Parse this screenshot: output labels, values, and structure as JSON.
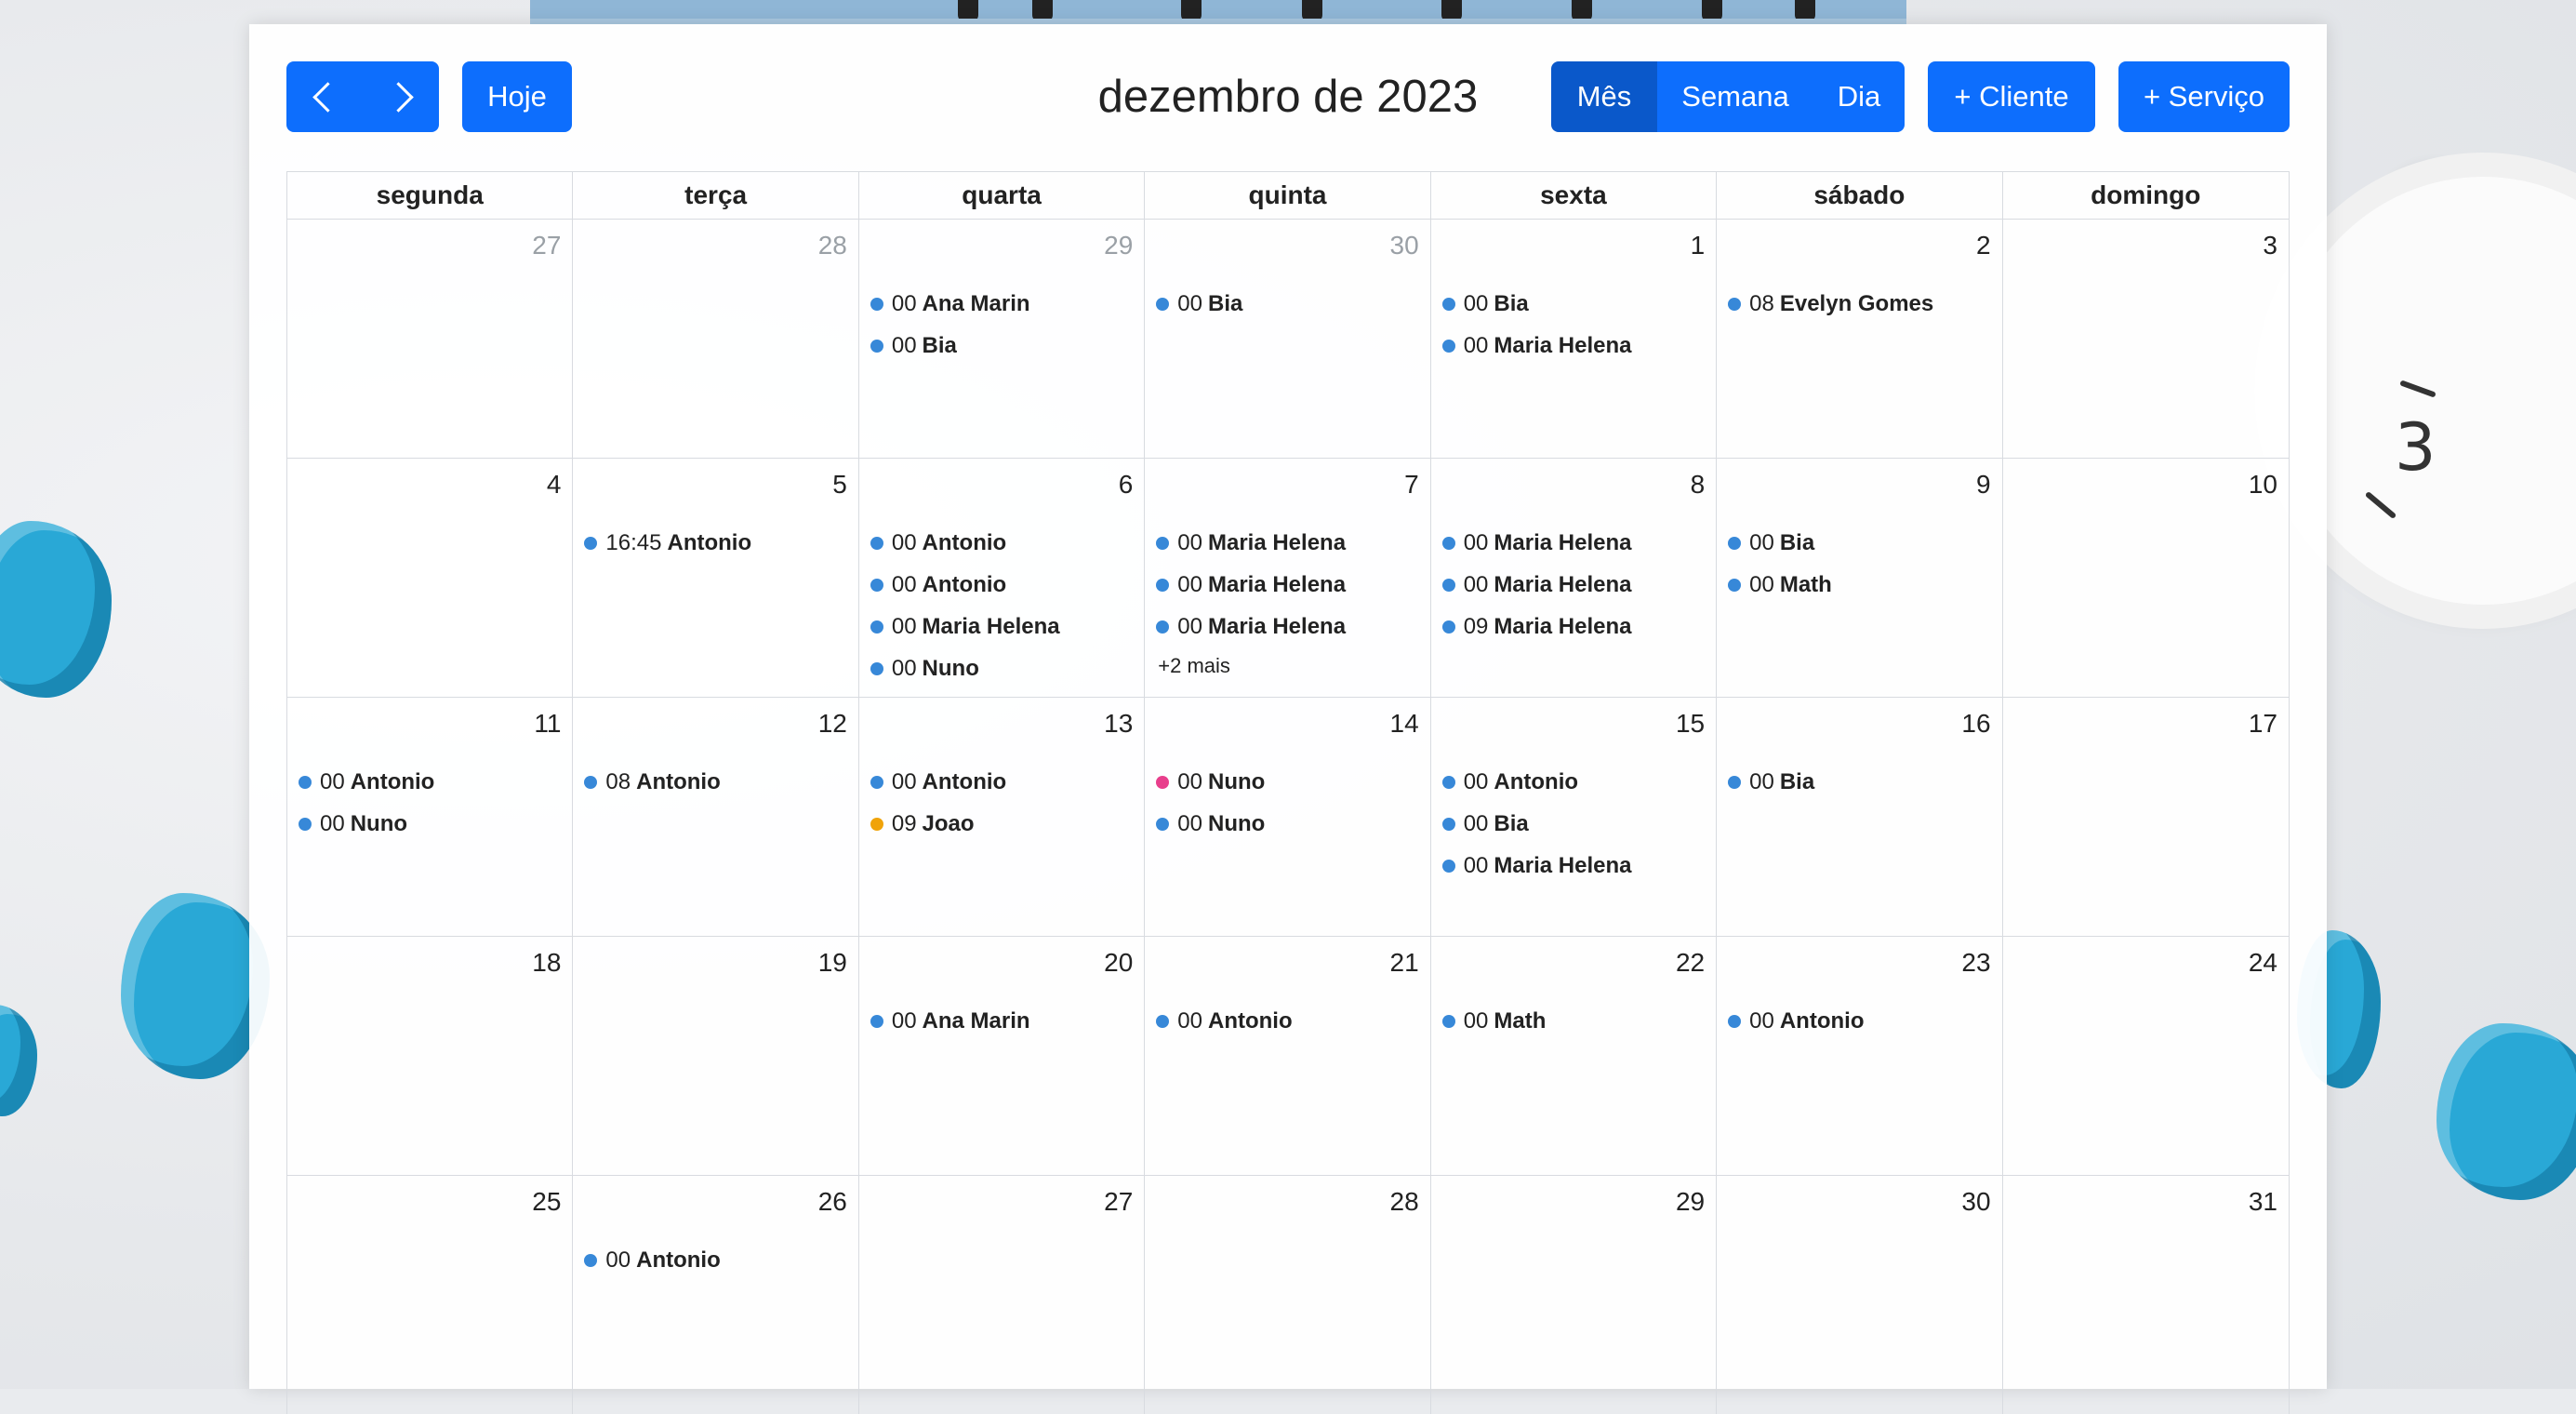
{
  "toolbar": {
    "prev_label": "",
    "next_label": "",
    "today_label": "Hoje",
    "title": "dezembro de 2023",
    "views": [
      "Mês",
      "Semana",
      "Dia"
    ],
    "active_view": "Mês",
    "add_client_label": "+ Cliente",
    "add_service_label": "+ Serviço"
  },
  "colors": {
    "primary": "#0d6efd",
    "primary_active": "#0a58ca",
    "event_blue": "#3788d8",
    "event_pink": "#e83e8c",
    "event_orange": "#f0a30a"
  },
  "weekdays": [
    "segunda",
    "terça",
    "quarta",
    "quinta",
    "sexta",
    "sábado",
    "domingo"
  ],
  "weeks": [
    [
      {
        "day": "27",
        "other": true,
        "events": []
      },
      {
        "day": "28",
        "other": true,
        "events": []
      },
      {
        "day": "29",
        "other": true,
        "events": [
          {
            "time": "00",
            "name": "Ana Marin",
            "color": "blue"
          },
          {
            "time": "00",
            "name": "Bia",
            "color": "blue"
          }
        ]
      },
      {
        "day": "30",
        "other": true,
        "events": [
          {
            "time": "00",
            "name": "Bia",
            "color": "blue"
          }
        ]
      },
      {
        "day": "1",
        "events": [
          {
            "time": "00",
            "name": "Bia",
            "color": "blue"
          },
          {
            "time": "00",
            "name": "Maria Helena",
            "color": "blue"
          }
        ]
      },
      {
        "day": "2",
        "events": [
          {
            "time": "08",
            "name": "Evelyn Gomes",
            "color": "blue"
          }
        ]
      },
      {
        "day": "3",
        "events": []
      }
    ],
    [
      {
        "day": "4",
        "events": []
      },
      {
        "day": "5",
        "events": [
          {
            "time": "16:45",
            "name": "Antonio",
            "color": "blue"
          }
        ]
      },
      {
        "day": "6",
        "events": [
          {
            "time": "00",
            "name": "Antonio",
            "color": "blue"
          },
          {
            "time": "00",
            "name": "Antonio",
            "color": "blue"
          },
          {
            "time": "00",
            "name": "Maria Helena",
            "color": "blue"
          },
          {
            "time": "00",
            "name": "Nuno",
            "color": "blue"
          }
        ]
      },
      {
        "day": "7",
        "events": [
          {
            "time": "00",
            "name": "Maria Helena",
            "color": "blue"
          },
          {
            "time": "00",
            "name": "Maria Helena",
            "color": "blue"
          },
          {
            "time": "00",
            "name": "Maria Helena",
            "color": "blue"
          }
        ],
        "more": "+2 mais"
      },
      {
        "day": "8",
        "events": [
          {
            "time": "00",
            "name": "Maria Helena",
            "color": "blue"
          },
          {
            "time": "00",
            "name": "Maria Helena",
            "color": "blue"
          },
          {
            "time": "09",
            "name": "Maria Helena",
            "color": "blue"
          }
        ]
      },
      {
        "day": "9",
        "events": [
          {
            "time": "00",
            "name": "Bia",
            "color": "blue"
          },
          {
            "time": "00",
            "name": "Math",
            "color": "blue"
          }
        ]
      },
      {
        "day": "10",
        "events": []
      }
    ],
    [
      {
        "day": "11",
        "events": [
          {
            "time": "00",
            "name": "Antonio",
            "color": "blue"
          },
          {
            "time": "00",
            "name": "Nuno",
            "color": "blue"
          }
        ]
      },
      {
        "day": "12",
        "events": [
          {
            "time": "08",
            "name": "Antonio",
            "color": "blue"
          }
        ]
      },
      {
        "day": "13",
        "events": [
          {
            "time": "00",
            "name": "Antonio",
            "color": "blue"
          },
          {
            "time": "09",
            "name": "Joao",
            "color": "orange"
          }
        ]
      },
      {
        "day": "14",
        "events": [
          {
            "time": "00",
            "name": "Nuno",
            "color": "pink"
          },
          {
            "time": "00",
            "name": "Nuno",
            "color": "blue"
          }
        ]
      },
      {
        "day": "15",
        "events": [
          {
            "time": "00",
            "name": "Antonio",
            "color": "blue"
          },
          {
            "time": "00",
            "name": "Bia",
            "color": "blue"
          },
          {
            "time": "00",
            "name": "Maria Helena",
            "color": "blue"
          }
        ]
      },
      {
        "day": "16",
        "events": [
          {
            "time": "00",
            "name": "Bia",
            "color": "blue"
          }
        ]
      },
      {
        "day": "17",
        "events": []
      }
    ],
    [
      {
        "day": "18",
        "events": []
      },
      {
        "day": "19",
        "events": []
      },
      {
        "day": "20",
        "events": [
          {
            "time": "00",
            "name": "Ana Marin",
            "color": "blue"
          }
        ]
      },
      {
        "day": "21",
        "events": [
          {
            "time": "00",
            "name": "Antonio",
            "color": "blue"
          }
        ]
      },
      {
        "day": "22",
        "events": [
          {
            "time": "00",
            "name": "Math",
            "color": "blue"
          }
        ]
      },
      {
        "day": "23",
        "events": [
          {
            "time": "00",
            "name": "Antonio",
            "color": "blue"
          }
        ]
      },
      {
        "day": "24",
        "events": []
      }
    ],
    [
      {
        "day": "25",
        "events": []
      },
      {
        "day": "26",
        "events": [
          {
            "time": "00",
            "name": "Antonio",
            "color": "blue"
          }
        ]
      },
      {
        "day": "27",
        "events": []
      },
      {
        "day": "28",
        "events": []
      },
      {
        "day": "29",
        "events": []
      },
      {
        "day": "30",
        "events": []
      },
      {
        "day": "31",
        "events": []
      }
    ]
  ]
}
